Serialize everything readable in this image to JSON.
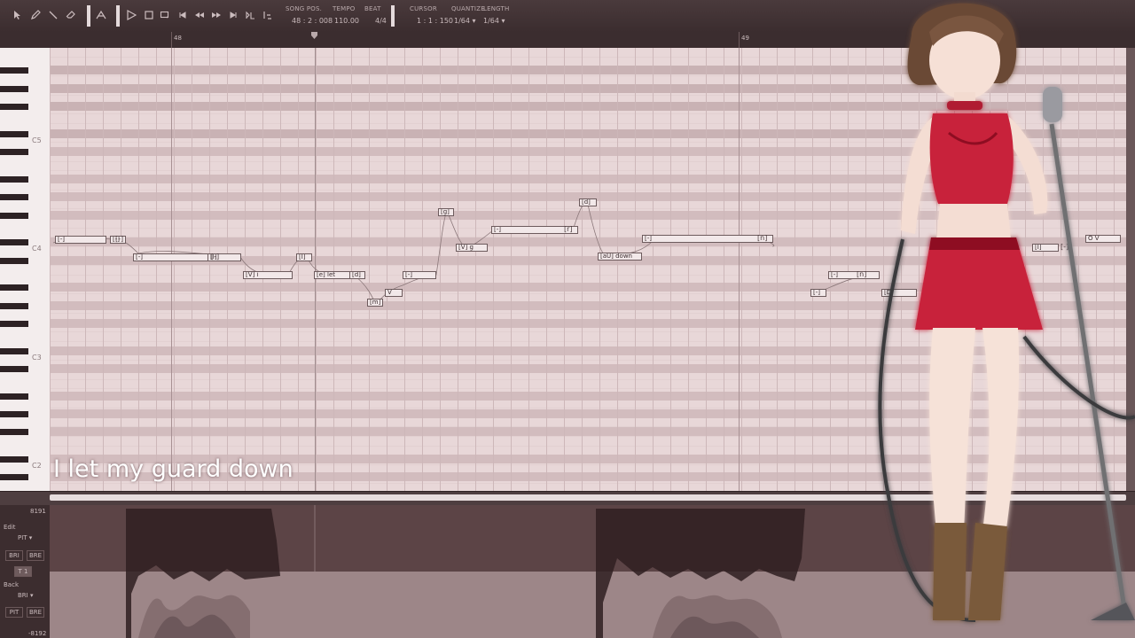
{
  "toolbar": {
    "song_pos_label": "SONG POS.",
    "song_pos_value": "48 : 2 : 008",
    "tempo_label": "TEMPO",
    "tempo_value": "110.00",
    "beat_label": "BEAT",
    "beat_value": "4/4",
    "cursor_label": "CURSOR",
    "cursor_value": "1 : 1 : 150",
    "quantize_label": "QUANTIZE",
    "quantize_value": "1/64",
    "length_label": "LENGTH",
    "length_value": "1/64",
    "tools": [
      "pointer-icon",
      "pencil-icon",
      "line-icon",
      "eraser-icon",
      "split-icon"
    ],
    "transport": [
      "play-icon",
      "stop-icon",
      "loop-icon",
      "go-start-icon",
      "rewind-icon",
      "fast-forward-icon",
      "go-end-icon",
      "auto-scroll-icon",
      "grid-icon"
    ]
  },
  "ruler": {
    "measures": [
      "48",
      "49"
    ]
  },
  "piano": {
    "octave_labels": [
      "C5",
      "C4",
      "C3",
      "C2"
    ]
  },
  "notes": [
    {
      "text": "[-]",
      "label": "[-]"
    },
    {
      "text": "[-]",
      "label": ""
    },
    {
      "text": "[-]",
      "label": "[-]"
    },
    {
      "text": "[I]",
      "label": ""
    },
    {
      "text": "[V] i",
      "label": ""
    },
    {
      "text": "[I]",
      "label": ""
    },
    {
      "text": "[e] let",
      "label": ""
    },
    {
      "text": "[d]",
      "label": ""
    },
    {
      "text": "[m]",
      "label": ""
    },
    {
      "text": "V",
      "label": ""
    },
    {
      "text": "[-]",
      "label": ""
    },
    {
      "text": "[g]",
      "label": ""
    },
    {
      "text": "[V] g",
      "label": ""
    },
    {
      "text": "[-]",
      "label": "[r]"
    },
    {
      "text": "[d]",
      "label": ""
    },
    {
      "text": "[aU] down",
      "label": ""
    },
    {
      "text": "[-]",
      "label": "[n]"
    },
    {
      "text": "[-]",
      "label": ""
    },
    {
      "text": "[-]",
      "label": "[n]"
    },
    {
      "text": "[D",
      "label": ""
    },
    {
      "text": "[I]",
      "label": "[-]"
    },
    {
      "text": "O V",
      "label": ""
    }
  ],
  "lyric": "I let my guard down",
  "controller": {
    "max_value": "8191",
    "min_value": "-8192",
    "edit_label": "Edit",
    "edit_param": "PIT",
    "edit_btn1": "BRI",
    "edit_btn2": "BRE",
    "edit_toggle": "T 1",
    "back_label": "Back",
    "back_param": "BRI",
    "back_btn1": "PIT",
    "back_btn2": "BRE"
  },
  "colors": {
    "toolbar_bg": "#3b2d2f",
    "roll_bg": "#e8d7d8",
    "note_fill": "#f2e8e9",
    "controller_bg": "#5a4244",
    "character_dress": "#c8203a"
  }
}
